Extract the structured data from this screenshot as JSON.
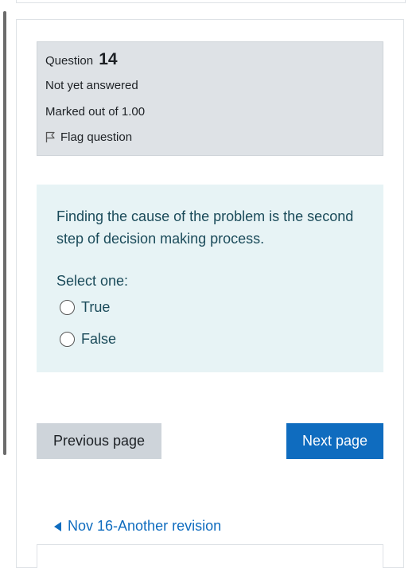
{
  "question_info": {
    "label": "Question",
    "number": "14",
    "state": "Not yet answered",
    "grade": "Marked out of 1.00",
    "flag_label": "Flag question"
  },
  "formulation": {
    "text": "Finding the cause of the problem is the second step of decision making process.",
    "prompt": "Select one:",
    "options": [
      {
        "label": "True",
        "selected": false
      },
      {
        "label": "False",
        "selected": false
      }
    ]
  },
  "navigation": {
    "previous_label": "Previous page",
    "next_label": "Next page"
  },
  "activity_link": {
    "label": "Nov 16-Another revision"
  },
  "colors": {
    "primary": "#0f6cbf",
    "info_bg": "#dee2e6",
    "formulation_bg": "#e7f3f5",
    "text_teal": "#1b4b5a"
  }
}
